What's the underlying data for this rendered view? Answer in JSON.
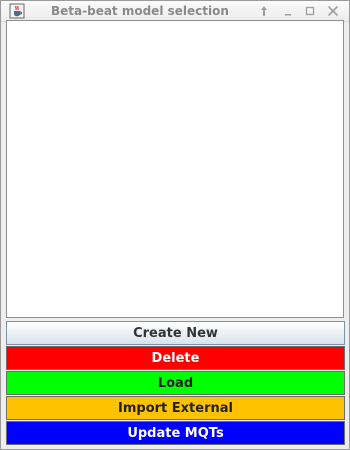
{
  "window": {
    "title": "Beta-beat model selection",
    "icon": "java-cup-icon",
    "controls": [
      "pin-icon",
      "minimize-icon",
      "maximize-icon",
      "close-icon"
    ]
  },
  "model_list": {
    "items": []
  },
  "buttons": {
    "create_new": {
      "label": "Create New",
      "color": "#dde6ef"
    },
    "delete": {
      "label": "Delete",
      "color": "#ff0000"
    },
    "load": {
      "label": "Load",
      "color": "#00ff00"
    },
    "import_external": {
      "label": "Import External",
      "color": "#ffc200"
    },
    "update_mqts": {
      "label": "Update MQTs",
      "color": "#0000ff"
    }
  }
}
